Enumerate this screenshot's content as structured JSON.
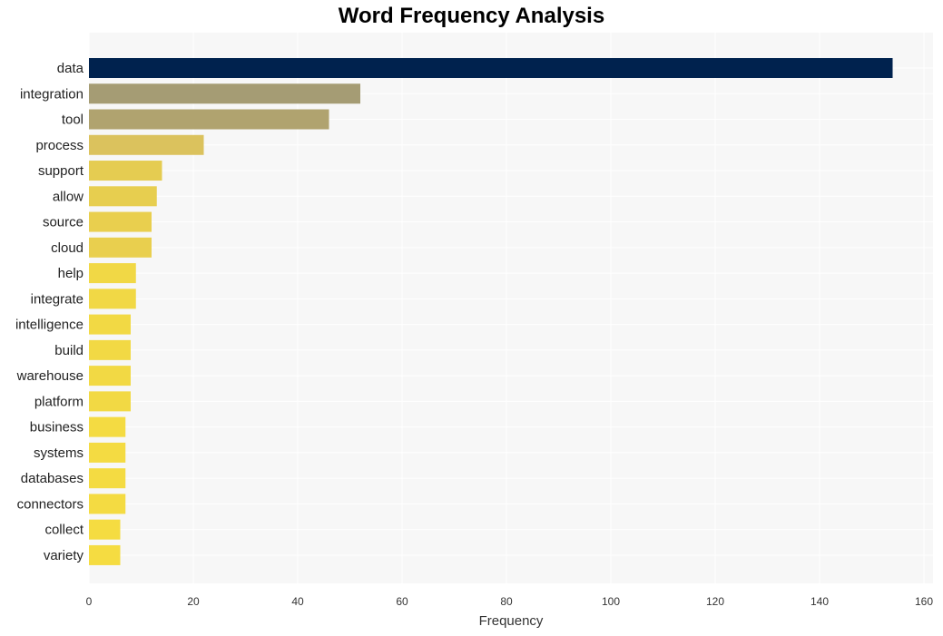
{
  "chart_data": {
    "type": "bar",
    "orientation": "horizontal",
    "title": "Word Frequency Analysis",
    "xlabel": "Frequency",
    "ylabel": "",
    "xlim": [
      0,
      162
    ],
    "xticks": [
      0,
      20,
      40,
      60,
      80,
      100,
      120,
      140,
      160
    ],
    "grid": true,
    "categories": [
      "data",
      "integration",
      "tool",
      "process",
      "support",
      "allow",
      "source",
      "cloud",
      "help",
      "integrate",
      "intelligence",
      "build",
      "warehouse",
      "platform",
      "business",
      "systems",
      "databases",
      "connectors",
      "collect",
      "variety"
    ],
    "values": [
      154,
      52,
      46,
      22,
      14,
      13,
      12,
      12,
      9,
      9,
      8,
      8,
      8,
      8,
      7,
      7,
      7,
      7,
      6,
      6
    ],
    "colors": [
      "#00224e",
      "#a59c74",
      "#b0a36f",
      "#dbc25d",
      "#e5cc51",
      "#e7ce4f",
      "#e9cf4e",
      "#e9cf4e",
      "#f1d845",
      "#f1d845",
      "#f2d944",
      "#f2d944",
      "#f2d944",
      "#f2d944",
      "#f4db42",
      "#f4db42",
      "#f4db42",
      "#f4db42",
      "#f5dc41",
      "#f5dc41"
    ]
  }
}
